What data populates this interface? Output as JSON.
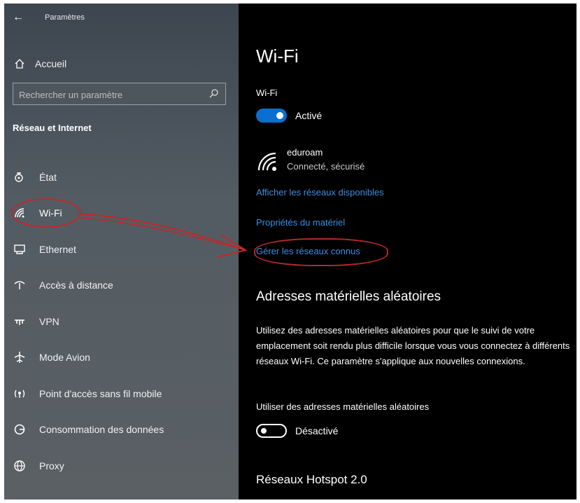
{
  "window": {
    "back_label": "←",
    "title": "Paramètres"
  },
  "sidebar": {
    "home_label": "Accueil",
    "search_placeholder": "Rechercher un paramètre",
    "section_title": "Réseau et Internet",
    "items": [
      {
        "label": "État",
        "icon": "status-icon"
      },
      {
        "label": "Wi-Fi",
        "icon": "wifi-icon",
        "selected": true
      },
      {
        "label": "Ethernet",
        "icon": "ethernet-icon"
      },
      {
        "label": "Accès à distance",
        "icon": "dialup-icon"
      },
      {
        "label": "VPN",
        "icon": "vpn-icon"
      },
      {
        "label": "Mode Avion",
        "icon": "airplane-icon"
      },
      {
        "label": "Point d'accès sans fil mobile",
        "icon": "hotspot-icon"
      },
      {
        "label": "Consommation des données",
        "icon": "data-usage-icon"
      },
      {
        "label": "Proxy",
        "icon": "globe-icon"
      }
    ]
  },
  "main": {
    "title": "Wi-Fi",
    "wifi_section_label": "Wi-Fi",
    "wifi_toggle": {
      "state": "on",
      "label": "Activé"
    },
    "network": {
      "name": "eduroam",
      "status": "Connecté, sécurisé"
    },
    "links": {
      "show_available": "Afficher les réseaux disponibles",
      "hardware_properties": "Propriétés du matériel",
      "manage_known": "Gérer les réseaux connus"
    },
    "random_hw": {
      "heading": "Adresses matérielles aléatoires",
      "description": "Utilisez des adresses matérielles aléatoires pour que le suivi de votre emplacement soit rendu plus difficile lorsque vous vous connectez à différents réseaux Wi-Fi. Ce paramètre s'applique aux nouvelles connexions.",
      "option_label": "Utiliser des adresses matérielles aléatoires",
      "toggle": {
        "state": "off",
        "label": "Désactivé"
      }
    },
    "hotspot_heading": "Réseaux Hotspot 2.0"
  },
  "colors": {
    "accent": "#0a6fd1",
    "link": "#3b8fe3",
    "annotation": "#c0282a",
    "content_bg": "#000000",
    "sidebar_bg": "#535c63"
  }
}
